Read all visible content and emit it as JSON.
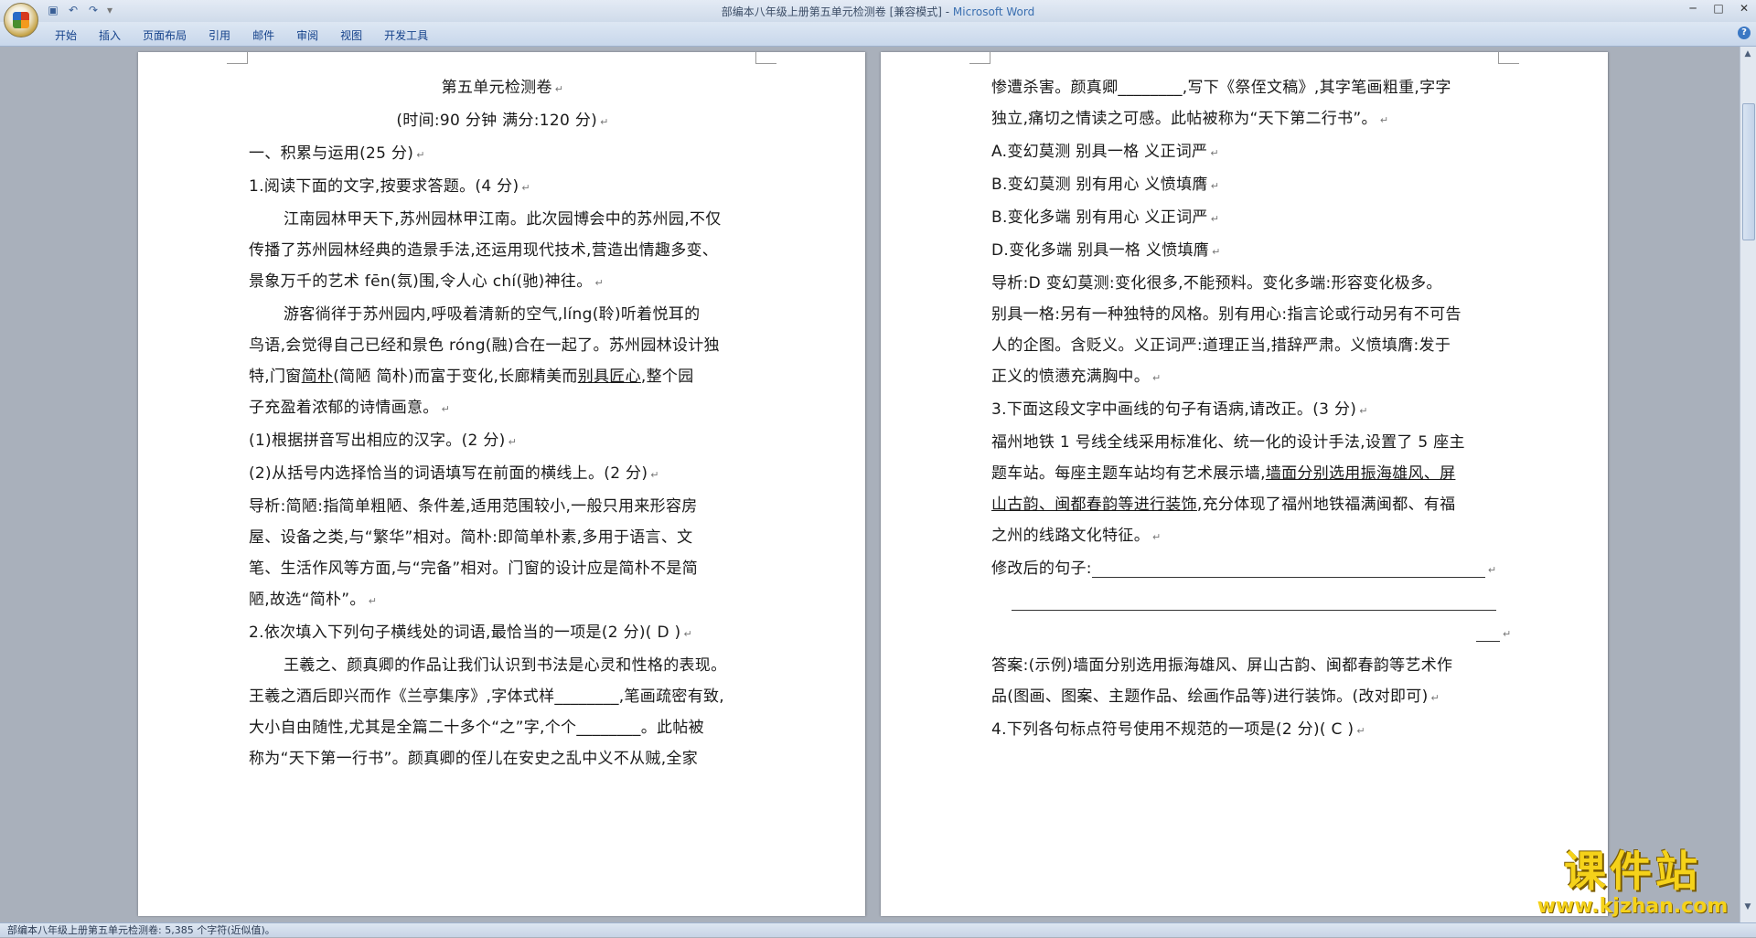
{
  "window": {
    "title": "部编本八年级上册第五单元检测卷 [兼容模式] - ",
    "app_name": "Microsoft Word",
    "controls": [
      "─",
      "□",
      "✕"
    ]
  },
  "qat": {
    "save": "▣",
    "undo": "↶",
    "redo": "↷",
    "more": "▾"
  },
  "ribbon": {
    "tabs": [
      "开始",
      "插入",
      "页面布局",
      "引用",
      "邮件",
      "审阅",
      "视图",
      "开发工具"
    ],
    "help": "?"
  },
  "page1": {
    "lines": [
      "第五单元检测卷",
      "(时间:90 分钟   满分:120 分)",
      "一、积累与运用(25 分)",
      "1.阅读下面的文字,按要求答题。(4 分)",
      "江南园林甲天下,苏州园林甲江南。此次园博会中的苏州园,不仅",
      "传播了苏州园林经典的造景手法,还运用现代技术,营造出情趣多变、",
      "景象万千的艺术 fēn(氛)围,令人心 chí(驰)神往。",
      "游客徜徉于苏州园内,呼吸着清新的空气,líng(聆)听着悦耳的",
      "鸟语,会觉得自己已经和景色 róng(融)合在一起了。苏州园林设计独",
      "特,门窗",
      "简朴",
      "(简陋  简朴)而富于变化,长廊精美而",
      "别具匠心",
      ",整个园",
      "子充盈着浓郁的诗情画意。",
      "(1)根据拼音写出相应的汉字。(2 分)",
      "(2)从括号内选择恰当的词语填写在前面的横线上。(2 分)",
      "导析:简陋:指简单粗陋、条件差,适用范围较小,一般只用来形容房",
      "屋、设备之类,与“繁华”相对。简朴:即简单朴素,多用于语言、文",
      "笔、生活作风等方面,与“完备”相对。门窗的设计应是简朴不是简",
      "陋,故选“简朴”。",
      "2.依次填入下列句子横线处的词语,最恰当的一项是(2 分)(  D   )",
      "王羲之、颜真卿的作品让我们认识到书法是心灵和性格的表现。",
      "王羲之酒后即兴而作《兰亭集序》,字体式样________,笔画疏密有致,",
      "大小自由随性,尤其是全篇二十多个“之”字,个个________。此帖被",
      "称为“天下第一行书”。颜真卿的侄儿在安史之乱中义不从贼,全家"
    ]
  },
  "page2": {
    "lines": [
      "惨遭杀害。颜真卿________,写下《祭侄文稿》,其字笔画粗重,字字",
      "独立,痛切之情读之可感。此帖被称为“天下第二行书”。",
      "A.变幻莫测  别具一格  义正词严",
      "B.变幻莫测  别有用心  义愤填膺",
      "B.变化多端  别有用心  义正词严",
      "D.变化多端  别具一格  义愤填膺",
      "导析:D  变幻莫测:变化很多,不能预料。变化多端:形容变化极多。",
      "别具一格:另有一种独特的风格。别有用心:指言论或行动另有不可告",
      "人的企图。含贬义。义正词严:道理正当,措辞严肃。义愤填膺:发于",
      "正义的愤懑充满胸中。",
      "3.下面这段文字中画线的句子有语病,请改正。(3 分)",
      "福州地铁 1 号线全线采用标准化、统一化的设计手法,设置了 5 座主",
      "题车站。每座主题车站均有艺术展示墙,",
      "墙面分别选用振海雄风、屏",
      "山古韵、闽都春韵等进行装饰",
      ",充分体现了福州地铁福满闽都、有福",
      "之州的线路文化特征。",
      "修改后的句子:",
      "答案:(示例)墙面分别选用振海雄风、屏山古韵、闽都春韵等艺术作",
      "品(图画、图案、主题作品、绘画作品等)进行装饰。(改对即可)",
      "4.下列各句标点符号使用不规范的一项是(2 分)(  C   )"
    ]
  },
  "status": {
    "text": "部编本八年级上册第五单元检测卷: 5,385 个字符(近似值)。"
  },
  "watermark": {
    "big": "课件站",
    "small": "www.kjzhan.com"
  },
  "colors": {
    "page_bg": "#a9b0bb",
    "ribbon_text": "#15428b",
    "watermark": "#f5d21a"
  }
}
